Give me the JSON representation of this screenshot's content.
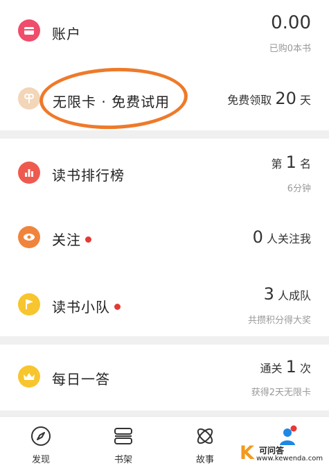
{
  "account": {
    "label": "账户",
    "balance": "0.00",
    "purchased": "已购0本书"
  },
  "unlimited": {
    "label": "无限卡 · 免费试用",
    "claim_prefix": "免费领取",
    "claim_days": "20",
    "claim_unit": "天"
  },
  "ranking": {
    "label": "读书排行榜",
    "rank_prefix": "第",
    "rank_value": "1",
    "rank_suffix": "名",
    "time": "6分钟"
  },
  "follow": {
    "label": "关注",
    "count": "0",
    "count_text": "人关注我"
  },
  "team": {
    "label": "读书小队",
    "count": "3",
    "count_text": "人成队",
    "sub": "共攒积分得大奖"
  },
  "quiz": {
    "label": "每日一答",
    "prefix": "通关",
    "count": "1",
    "suffix": "次",
    "sub": "获得2天无限卡"
  },
  "tabs": [
    {
      "label": "发现",
      "icon": "compass-icon"
    },
    {
      "label": "书架",
      "icon": "bookshelf-icon"
    },
    {
      "label": "故事",
      "icon": "story-icon"
    },
    {
      "label": "我",
      "icon": "profile-icon"
    }
  ],
  "watermark": {
    "letter": "K",
    "title": "可问答",
    "site": "www.kewenda.com"
  },
  "colors": {
    "account": "#ef4d6b",
    "unlimited": "#f3d5b7",
    "ranking": "#ef5a4f",
    "follow": "#f0843c",
    "team": "#f7c52d",
    "quiz": "#f7c52d",
    "highlight": "#ee7a2a",
    "dot": "#e53935"
  }
}
